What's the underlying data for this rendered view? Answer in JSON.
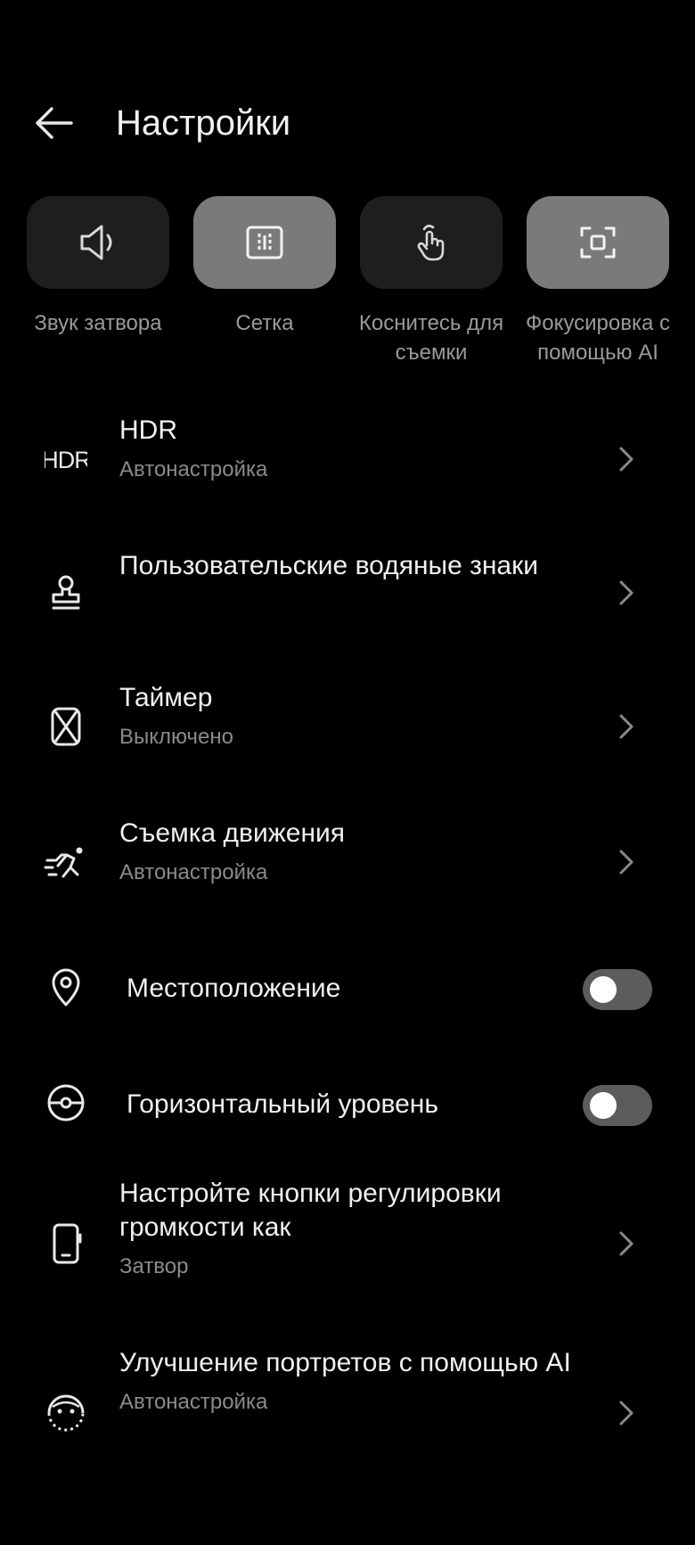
{
  "header": {
    "title": "Настройки",
    "back_icon": "arrow-left-icon"
  },
  "quick_settings": [
    {
      "label": "Звук затвора",
      "icon": "speaker-icon",
      "active": false
    },
    {
      "label": "Сетка",
      "icon": "grid-icon",
      "active": true
    },
    {
      "label": "Коснитесь для съемки",
      "icon": "touch-icon",
      "active": false
    },
    {
      "label": "Фокусировка с помощью AI",
      "icon": "focus-frame-icon",
      "active": true
    }
  ],
  "settings": {
    "hdr": {
      "title": "HDR",
      "subtitle": "Автонастройка",
      "icon": "hdr-icon"
    },
    "watermark": {
      "title": "Пользовательские водяные знаки",
      "icon": "stamp-icon"
    },
    "timer": {
      "title": "Таймер",
      "subtitle": "Выключено",
      "icon": "hourglass-icon"
    },
    "motion": {
      "title": "Съемка движения",
      "subtitle": "Автонастройка",
      "icon": "running-icon"
    },
    "location": {
      "title": "Местоположение",
      "icon": "location-pin-icon",
      "enabled": false
    },
    "level": {
      "title": "Горизонтальный уровень",
      "icon": "level-icon",
      "enabled": false
    },
    "volume_keys": {
      "title": "Настройте кнопки регулировки громкости как",
      "subtitle": "Затвор",
      "icon": "phone-side-button-icon"
    },
    "portrait": {
      "title": "Улучшение портретов с помощью AI",
      "subtitle": "Автонастройка",
      "icon": "face-enhance-icon"
    }
  },
  "colors": {
    "background": "#000000",
    "tile": "#1e1e1e",
    "tile_active": "#7a7a7a",
    "secondary_text": "#8a8a8a",
    "toggle_off": "#5c5c5c"
  }
}
